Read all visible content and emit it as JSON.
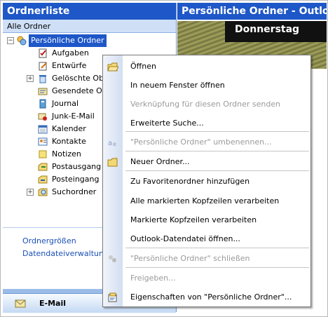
{
  "left_pane": {
    "title": "Ordnerliste",
    "all_folders": "Alle Ordner",
    "root": "Persönliche Ordner",
    "folders": [
      {
        "label": "Aufgaben",
        "icon": "tasks-icon"
      },
      {
        "label": "Entwürfe",
        "icon": "drafts-icon"
      },
      {
        "label": "Gelöschte Objekte",
        "icon": "deleted-items-icon",
        "expandable": true
      },
      {
        "label": "Gesendete Objekte",
        "icon": "sent-items-icon"
      },
      {
        "label": "Journal",
        "icon": "journal-icon"
      },
      {
        "label": "Junk-E-Mail",
        "icon": "junk-mail-icon"
      },
      {
        "label": "Kalender",
        "icon": "calendar-icon"
      },
      {
        "label": "Kontakte",
        "icon": "contacts-icon"
      },
      {
        "label": "Notizen",
        "icon": "notes-icon"
      },
      {
        "label": "Postausgang",
        "icon": "outbox-icon"
      },
      {
        "label": "Posteingang",
        "icon": "inbox-icon"
      },
      {
        "label": "Suchordner",
        "icon": "search-folder-icon",
        "expandable": true
      }
    ],
    "links": [
      "Ordnergrößen",
      "Datendateiverwaltung"
    ],
    "mail_button": "E-Mail"
  },
  "right_pane": {
    "title": "Persönliche Ordner - Outlook",
    "banner_text": "Donnerstag"
  },
  "context_menu": {
    "items": [
      {
        "label": "Öffnen",
        "icon": "open-folder-icon",
        "enabled": true
      },
      {
        "label": "In neuem Fenster öffnen",
        "enabled": true
      },
      {
        "label": "Verknüpfung für diesen Ordner senden",
        "enabled": false
      },
      {
        "label": "Erweiterte Suche...",
        "enabled": true
      },
      {
        "label": "\"Persönliche Ordner\" umbenennen...",
        "icon": "rename-icon",
        "enabled": false
      },
      {
        "label": "Neuer Ordner...",
        "icon": "new-folder-icon",
        "enabled": true
      },
      {
        "label": "Zu Favoritenordner hinzufügen",
        "enabled": true
      },
      {
        "label": "Alle markierten Kopfzeilen verarbeiten",
        "enabled": true
      },
      {
        "label": "Markierte Kopfzeilen verarbeiten",
        "enabled": true
      },
      {
        "label": "Outlook-Datendatei öffnen...",
        "enabled": true
      },
      {
        "label": "\"Persönliche Ordner\" schließen",
        "icon": "close-data-file-icon",
        "enabled": false
      },
      {
        "label": "Freigeben...",
        "enabled": false
      },
      {
        "label": "Eigenschaften von \"Persönliche Ordner\"...",
        "icon": "properties-icon",
        "enabled": true
      }
    ]
  },
  "colors": {
    "title_bar": "#1e57c8",
    "link": "#1a4fb5",
    "disabled": "#9a9a9a"
  }
}
